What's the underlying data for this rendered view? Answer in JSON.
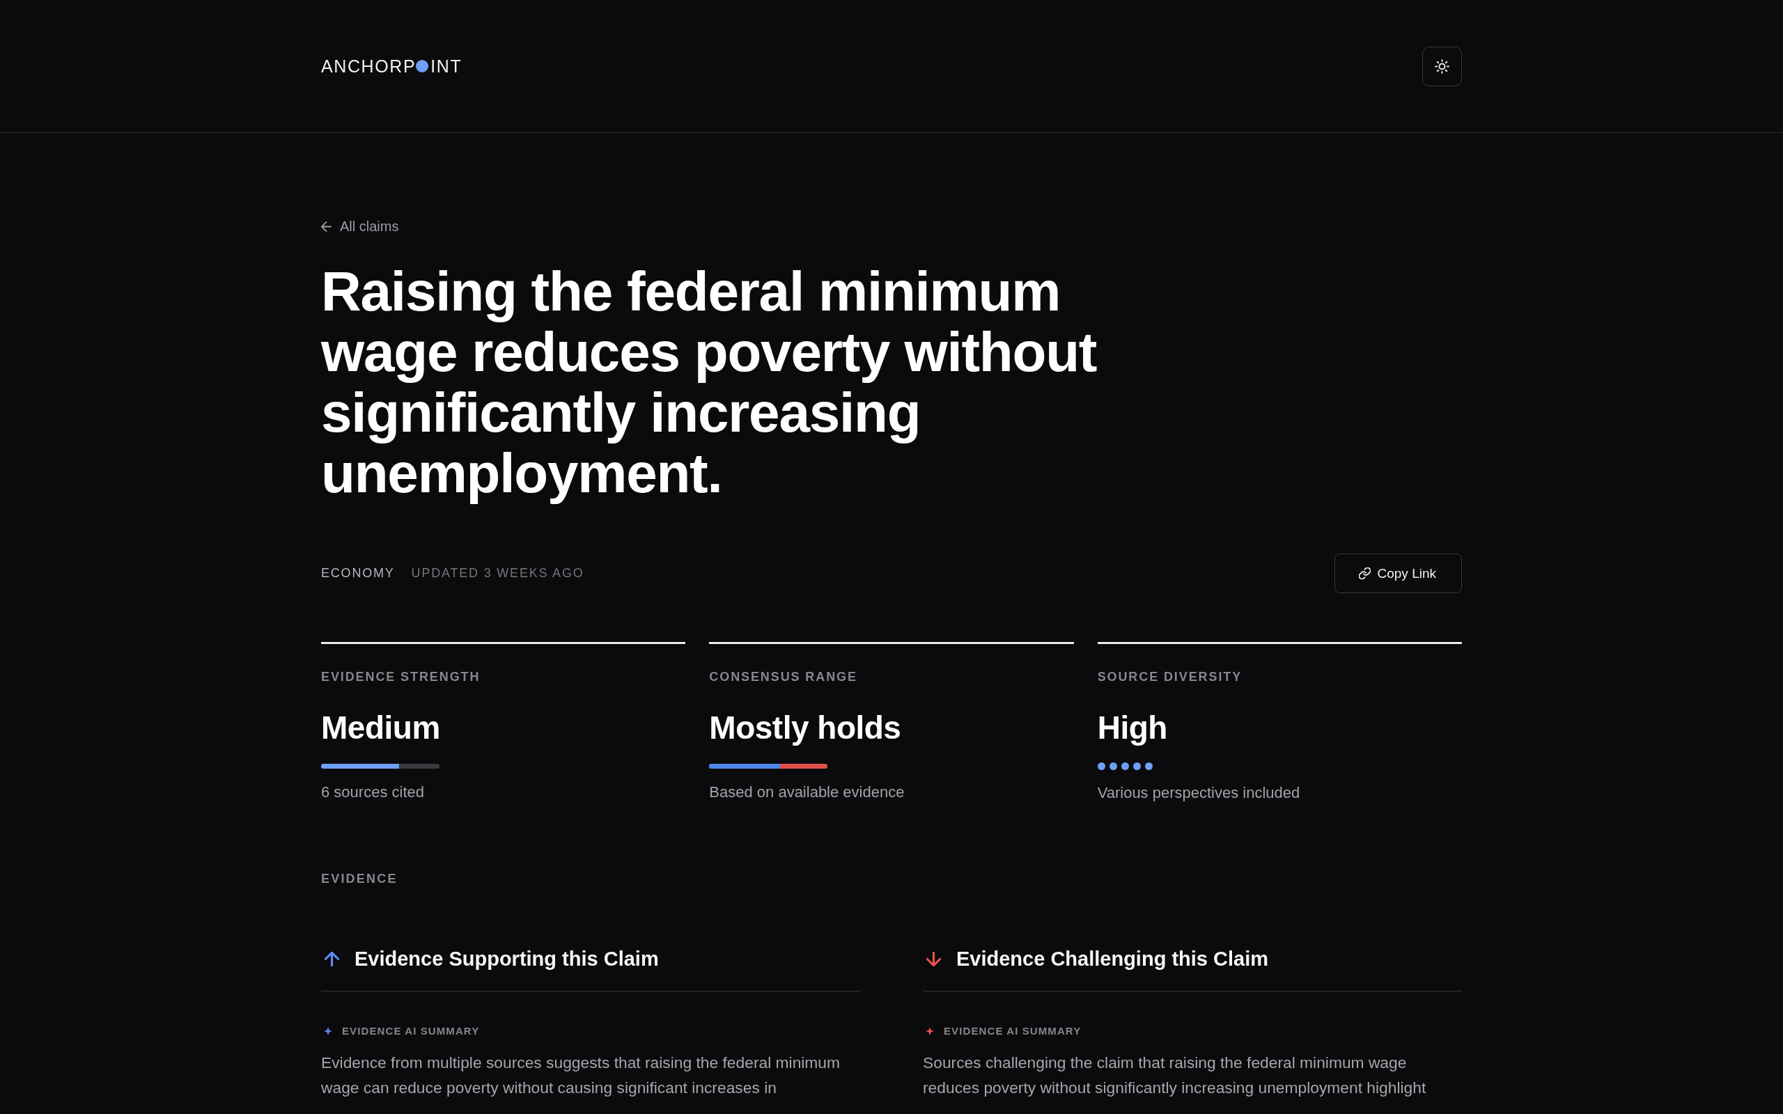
{
  "header": {
    "logo_before_dot": "ANCHORP",
    "logo_after_dot": "INT"
  },
  "back_link": {
    "label": "All claims"
  },
  "claim": {
    "title": "Raising the federal minimum wage reduces poverty without significantly increasing unemployment.",
    "category": "ECONOMY",
    "updated": "UPDATED 3 WEEKS AGO"
  },
  "copy_link_button": {
    "label": "Copy Link"
  },
  "metrics": [
    {
      "kind": "bar",
      "label": "EVIDENCE STRENGTH",
      "value": "Medium",
      "level": 0.66,
      "note": "6 sources cited"
    },
    {
      "kind": "split",
      "label": "CONSENSUS RANGE",
      "value": "Mostly holds",
      "level": 0.6,
      "note": "Based on available evidence"
    },
    {
      "kind": "dots",
      "label": "SOURCE DIVERSITY",
      "value": "High",
      "stars": 5,
      "note": "Various perspectives included"
    }
  ],
  "evidence": {
    "section_label": "EVIDENCE",
    "columns": [
      {
        "kind": "supporting",
        "heading": "Evidence Supporting this Claim",
        "summary_label": "EVIDENCE AI SUMMARY",
        "summary": "Evidence from multiple sources suggests that raising the federal minimum wage can reduce poverty without causing significant increases in"
      },
      {
        "kind": "challenging",
        "heading": "Evidence Challenging this Claim",
        "summary_label": "EVIDENCE AI SUMMARY",
        "summary": "Sources challenging the claim that raising the federal minimum wage reduces poverty without significantly increasing unemployment highlight"
      }
    ]
  }
}
